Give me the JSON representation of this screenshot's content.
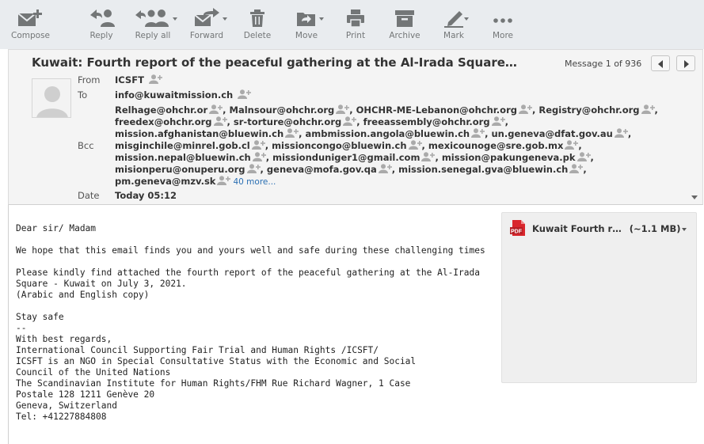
{
  "toolbar": {
    "compose": "Compose",
    "reply": "Reply",
    "reply_all": "Reply all",
    "forward": "Forward",
    "delete": "Delete",
    "move": "Move",
    "print": "Print",
    "archive": "Archive",
    "mark": "Mark",
    "more": "More"
  },
  "message": {
    "subject": "Kuwait: Fourth report of the peaceful gathering at the Al-Irada Square…",
    "counter": "Message 1 of 936",
    "labels": {
      "from": "From",
      "to": "To",
      "bcc": "Bcc",
      "date": "Date"
    },
    "from": "ICSFT",
    "to": "info@kuwaitmission.ch",
    "bcc_lines": [
      [
        "Relhage@ohchr.or",
        "Malnsour@ohchr.org",
        "OHCHR-ME-Lebanon@ohchr.org",
        "Registry@ohchr.org"
      ],
      [
        "freedex@ohchr.org",
        "sr-torture@ohchr.org",
        "freeassembly@ohchr.org"
      ],
      [
        "mission.afghanistan@bluewin.ch",
        "ambmission.angola@bluewin.ch",
        "un.geneva@dfat.gov.au"
      ],
      [
        "misginchile@minrel.gob.cl",
        "missioncongo@bluewin.ch",
        "mexicounoge@sre.gob.mx"
      ],
      [
        "mission.nepal@bluewin.ch",
        "missionduniger1@gmail.com",
        "mission@pakungeneva.pk"
      ],
      [
        "misionperu@onuperu.org",
        "geneva@mofa.gov.qa",
        "mission.senegal.gva@bluewin.ch"
      ],
      [
        "pm.geneva@mzv.sk"
      ]
    ],
    "more_recipients": "40 more...",
    "date": "Today 05:12"
  },
  "body": "Dear sir/ Madam\n\nWe hope that this email finds you and yours well and safe during these challenging times\n\nPlease kindly find attached the fourth report of the peaceful gathering at the Al-Irada\nSquare - Kuwait on July 3, 2021.\n(Arabic and English copy)\n\nStay safe\n--\nWith best regards,\nInternational Council Supporting Fair Trial and Human Rights /ICSFT/\nICSFT is an NGO in Special Consultative Status with the Economic and Social\nCouncil of the United Nations\nThe Scandinavian Institute for Human Rights/FHM Rue Richard Wagner, 1 Case\nPostale 128 1211 Genève 20\nGeneva, Switzerland\nTel: +41227884808",
  "attachment": {
    "icon_text": "PDF",
    "name": "Kuwait Fourth r…",
    "size": "(~1.1 MB)"
  },
  "colors": {
    "toolbar_bg": "#e9ecef",
    "pdf_red": "#d9262c",
    "link": "#2a6fb3"
  }
}
